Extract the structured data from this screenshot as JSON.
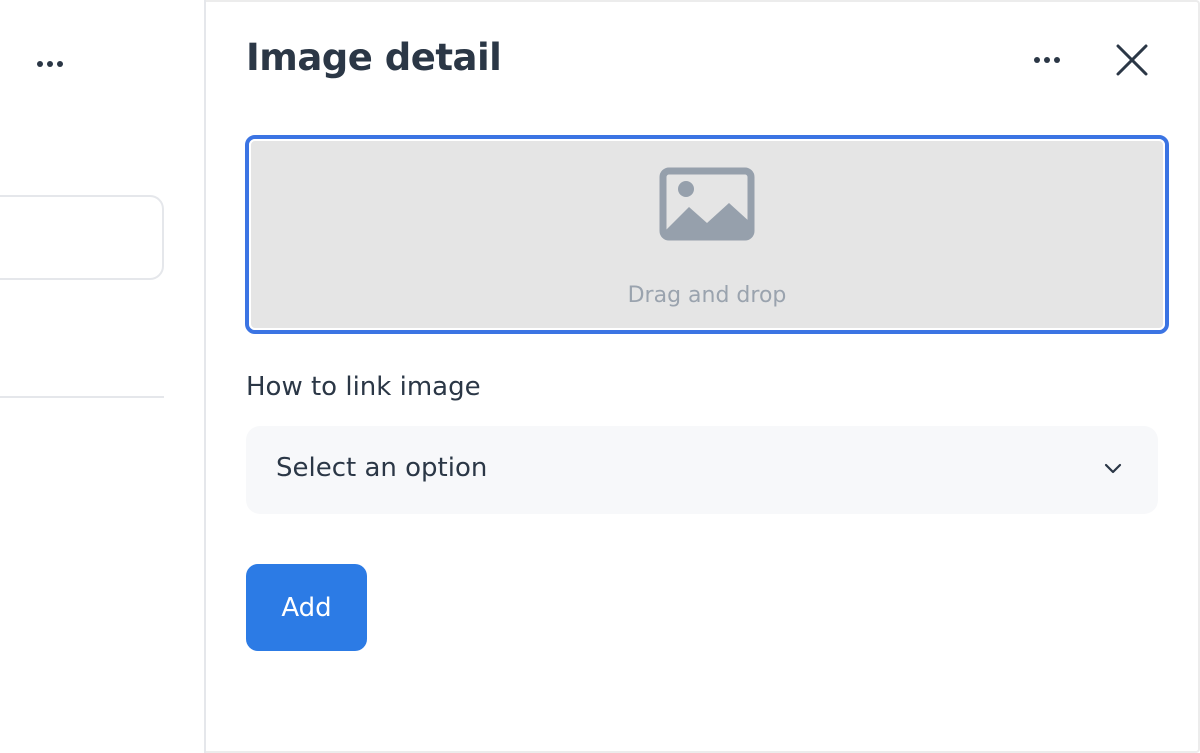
{
  "panel": {
    "title": "Image detail",
    "more_icon": "more-horizontal-icon",
    "close_icon": "close-icon"
  },
  "dropzone": {
    "icon": "image-icon",
    "text": "Drag and drop"
  },
  "link_field": {
    "label": "How to link image",
    "selected": "Select an option",
    "icon": "chevron-down-icon"
  },
  "actions": {
    "add_label": "Add"
  },
  "colors": {
    "accent": "#2c7be5",
    "focus_border": "#3b74e3",
    "text": "#2b3746",
    "muted": "#9aa3ae"
  }
}
